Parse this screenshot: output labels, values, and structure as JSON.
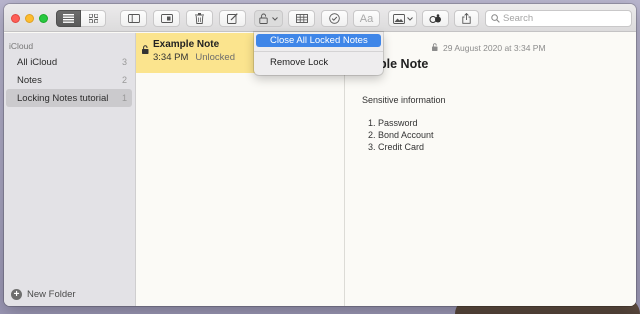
{
  "toolbar": {
    "buttons": {
      "list_view": "list-view-icon",
      "gallery_view": "gallery-view-icon",
      "sidebar": "sidebar-icon",
      "attachments": "attachments-icon",
      "delete": "trash-icon",
      "compose": "compose-icon",
      "lock": "lock-icon",
      "table": "table-icon",
      "checklist": "checklist-icon",
      "format_label": "Aa",
      "media": "media-icon",
      "collaborate": "collaborate-icon",
      "share": "share-icon"
    },
    "search_placeholder": "Search"
  },
  "sidebar": {
    "group_label": "iCloud",
    "items": [
      {
        "label": "All iCloud",
        "count": "3"
      },
      {
        "label": "Notes",
        "count": "2"
      },
      {
        "label": "Locking Notes tutorial",
        "count": "1"
      }
    ],
    "new_folder_label": "New Folder"
  },
  "note_list": {
    "items": [
      {
        "title": "Example Note",
        "time": "3:34 PM",
        "status": "Unlocked"
      }
    ]
  },
  "editor": {
    "date": "29 August 2020 at 3:34 PM",
    "title": "xample Note",
    "subtitle": "Sensitive information",
    "list": [
      {
        "num": "1.",
        "text": "Password"
      },
      {
        "num": "2.",
        "text": "Bond Account"
      },
      {
        "num": "3.",
        "text": "Credit Card"
      }
    ]
  },
  "lock_menu": {
    "items": [
      "Close All Locked Notes",
      "Remove Lock"
    ],
    "highlighted": "Close All Locked Notes"
  },
  "colors": {
    "accent": "#3f86e8",
    "note_highlight": "#fbe48e",
    "sidebar_bg": "#e3e2e6"
  }
}
